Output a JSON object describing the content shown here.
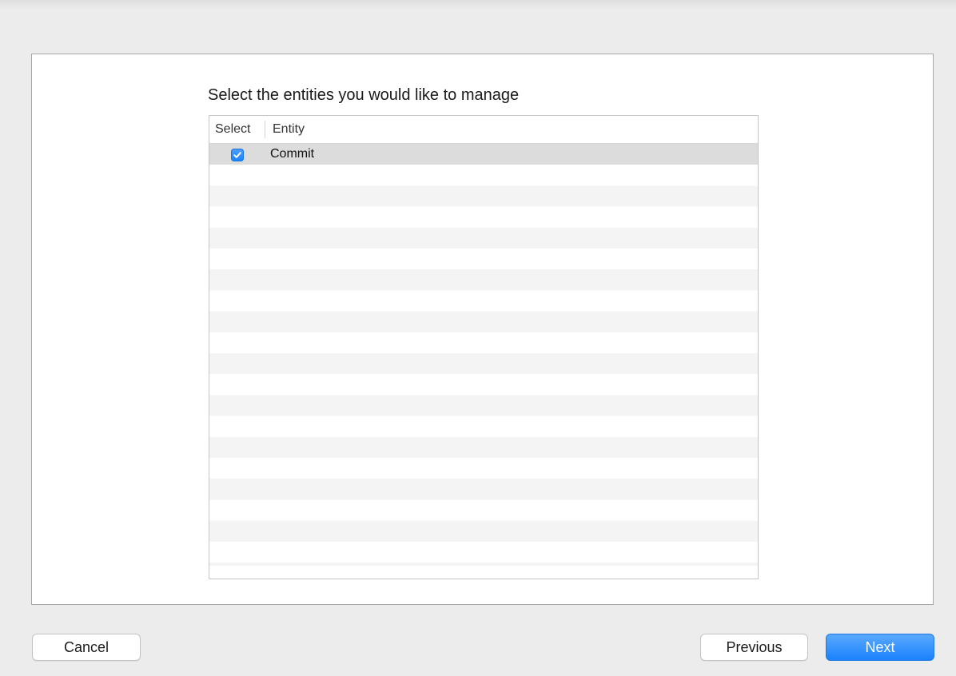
{
  "wizard": {
    "heading": "Select the entities you would like to manage"
  },
  "table": {
    "columns": {
      "select": "Select",
      "entity": "Entity"
    },
    "rows": [
      {
        "selected": true,
        "entity": "Commit"
      }
    ]
  },
  "footer": {
    "cancel_label": "Cancel",
    "previous_label": "Previous",
    "next_label": "Next"
  },
  "colors": {
    "accent": "#1a82fb",
    "window_background": "#ececec",
    "selected_row": "#dcdcdc",
    "stripe": "#f4f4f4"
  },
  "icons": {
    "checkbox": "checkmark-icon"
  }
}
